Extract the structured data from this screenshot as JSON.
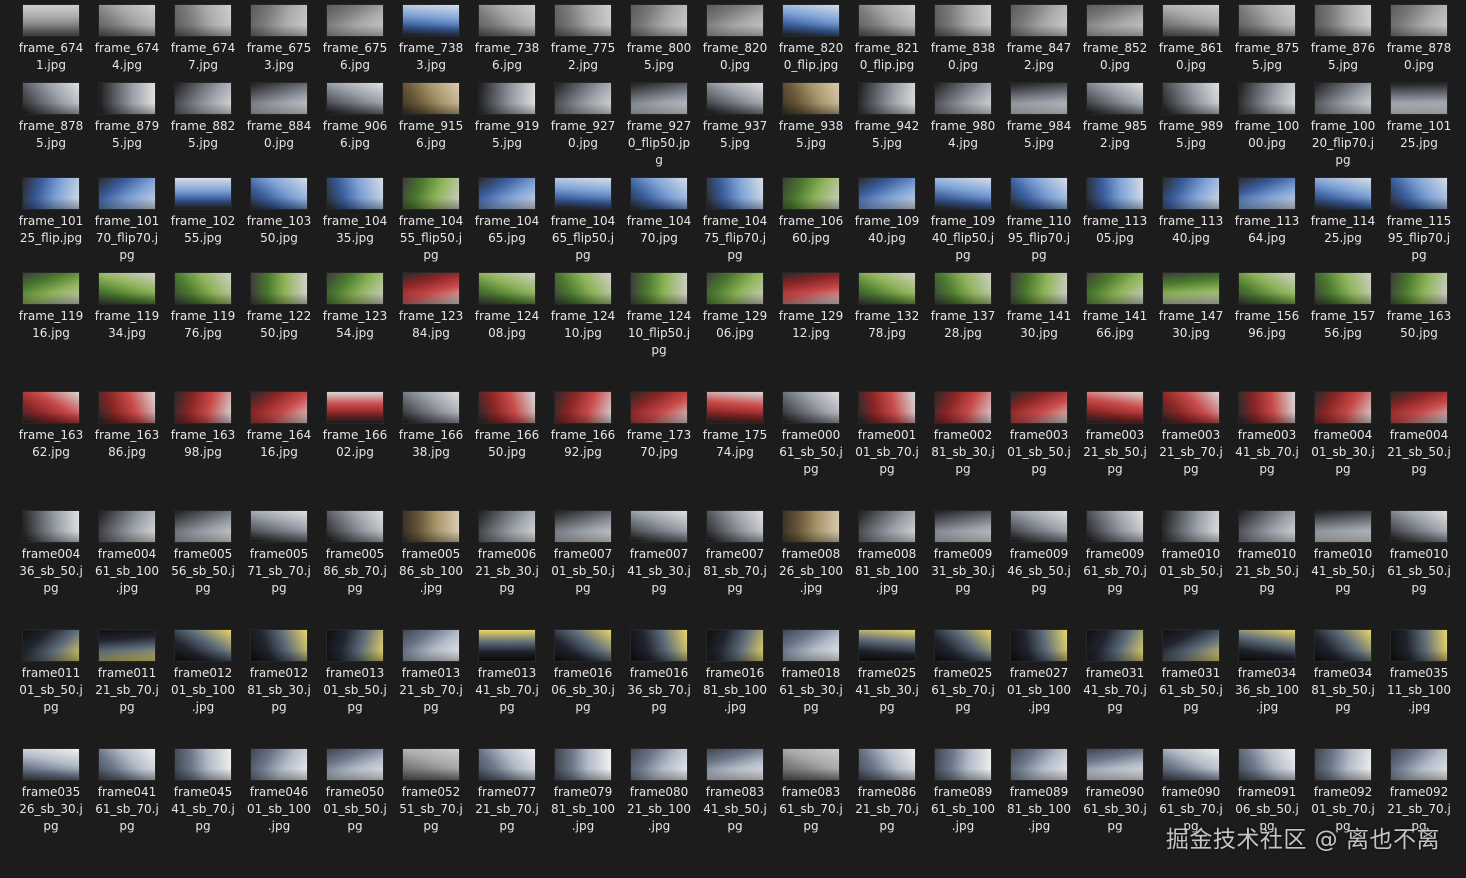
{
  "watermark": "掘金技术社区 @ 离也不离",
  "files": [
    [
      "frame_674\n1.jpg",
      "frame_674\n4.jpg",
      "frame_674\n7.jpg",
      "frame_675\n3.jpg",
      "frame_675\n6.jpg",
      "frame_738\n3.jpg",
      "frame_738\n6.jpg",
      "frame_775\n2.jpg",
      "frame_800\n5.jpg",
      "frame_820\n0.jpg",
      "frame_820\n0_flip.jpg",
      "frame_821\n0_flip.jpg",
      "frame_838\n0.jpg",
      "frame_847\n2.jpg",
      "frame_852\n0.jpg",
      "frame_861\n0.jpg",
      "frame_875\n5.jpg",
      "frame_876\n5.jpg",
      "frame_878\n0.jpg"
    ],
    [
      "frame_878\n5.jpg",
      "frame_879\n5.jpg",
      "frame_882\n5.jpg",
      "frame_884\n0.jpg",
      "frame_906\n6.jpg",
      "frame_915\n6.jpg",
      "frame_919\n5.jpg",
      "frame_927\n0.jpg",
      "frame_927\n0_flip50.jp\ng",
      "frame_937\n5.jpg",
      "frame_938\n5.jpg",
      "frame_942\n5.jpg",
      "frame_980\n4.jpg",
      "frame_984\n5.jpg",
      "frame_985\n2.jpg",
      "frame_989\n5.jpg",
      "frame_100\n00.jpg",
      "frame_100\n20_flip70.j\npg",
      "frame_101\n25.jpg"
    ],
    [
      "frame_101\n25_flip.jpg",
      "frame_101\n70_flip70.j\npg",
      "frame_102\n55.jpg",
      "frame_103\n50.jpg",
      "frame_104\n35.jpg",
      "frame_104\n55_flip50.j\npg",
      "frame_104\n65.jpg",
      "frame_104\n65_flip50.j\npg",
      "frame_104\n70.jpg",
      "frame_104\n75_flip70.j\npg",
      "frame_106\n60.jpg",
      "frame_109\n40.jpg",
      "frame_109\n40_flip50.j\npg",
      "frame_110\n95_flip70.j\npg",
      "frame_113\n05.jpg",
      "frame_113\n40.jpg",
      "frame_113\n64.jpg",
      "frame_114\n25.jpg",
      "frame_115\n95_flip70.j\npg"
    ],
    [
      "frame_119\n16.jpg",
      "frame_119\n34.jpg",
      "frame_119\n76.jpg",
      "frame_122\n50.jpg",
      "frame_123\n54.jpg",
      "frame_123\n84.jpg",
      "frame_124\n08.jpg",
      "frame_124\n10.jpg",
      "frame_124\n10_flip50.j\npg",
      "frame_129\n06.jpg",
      "frame_129\n12.jpg",
      "frame_132\n78.jpg",
      "frame_137\n28.jpg",
      "frame_141\n30.jpg",
      "frame_141\n66.jpg",
      "frame_147\n30.jpg",
      "frame_156\n96.jpg",
      "frame_157\n56.jpg",
      "frame_163\n50.jpg"
    ],
    [
      "frame_163\n62.jpg",
      "frame_163\n86.jpg",
      "frame_163\n98.jpg",
      "frame_164\n16.jpg",
      "frame_166\n02.jpg",
      "frame_166\n38.jpg",
      "frame_166\n50.jpg",
      "frame_166\n92.jpg",
      "frame_173\n70.jpg",
      "frame_175\n74.jpg",
      "frame000\n61_sb_50.j\npg",
      "frame001\n01_sb_70.j\npg",
      "frame002\n81_sb_30.j\npg",
      "frame003\n01_sb_50.j\npg",
      "frame003\n21_sb_50.j\npg",
      "frame003\n21_sb_70.j\npg",
      "frame003\n41_sb_70.j\npg",
      "frame004\n01_sb_30.j\npg",
      "frame004\n21_sb_50.j\npg"
    ],
    [
      "frame004\n36_sb_50.j\npg",
      "frame004\n61_sb_100\n.jpg",
      "frame005\n56_sb_50.j\npg",
      "frame005\n71_sb_70.j\npg",
      "frame005\n86_sb_70.j\npg",
      "frame005\n86_sb_100\n.jpg",
      "frame006\n21_sb_30.j\npg",
      "frame007\n01_sb_50.j\npg",
      "frame007\n41_sb_30.j\npg",
      "frame007\n81_sb_70.j\npg",
      "frame008\n26_sb_100\n.jpg",
      "frame008\n81_sb_100\n.jpg",
      "frame009\n31_sb_30.j\npg",
      "frame009\n46_sb_50.j\npg",
      "frame009\n61_sb_70.j\npg",
      "frame010\n01_sb_50.j\npg",
      "frame010\n21_sb_50.j\npg",
      "frame010\n41_sb_50.j\npg",
      "frame010\n61_sb_50.j\npg"
    ],
    [
      "frame011\n01_sb_50.j\npg",
      "frame011\n21_sb_70.j\npg",
      "frame012\n01_sb_100\n.jpg",
      "frame012\n81_sb_30.j\npg",
      "frame013\n01_sb_50.j\npg",
      "frame013\n21_sb_70.j\npg",
      "frame013\n41_sb_70.j\npg",
      "frame016\n06_sb_30.j\npg",
      "frame016\n36_sb_70.j\npg",
      "frame016\n81_sb_100\n.jpg",
      "frame018\n61_sb_30.j\npg",
      "frame025\n41_sb_30.j\npg",
      "frame025\n61_sb_70.j\npg",
      "frame027\n01_sb_100\n.jpg",
      "frame031\n41_sb_70.j\npg",
      "frame031\n61_sb_50.j\npg",
      "frame034\n36_sb_100\n.jpg",
      "frame034\n81_sb_50.j\npg",
      "frame035\n11_sb_100\n.jpg"
    ],
    [
      "frame035\n26_sb_30.j\npg",
      "frame041\n61_sb_70.j\npg",
      "frame045\n41_sb_70.j\npg",
      "frame046\n01_sb_100\n.jpg",
      "frame050\n01_sb_50.j\npg",
      "frame052\n51_sb_70.j\npg",
      "frame077\n21_sb_70.j\npg",
      "frame079\n81_sb_100\n.jpg",
      "frame080\n21_sb_100\n.jpg",
      "frame083\n41_sb_50.j\npg",
      "frame083\n61_sb_70.j\npg",
      "frame086\n21_sb_70.j\npg",
      "frame089\n61_sb_100\n.jpg",
      "frame089\n81_sb_100\n.jpg",
      "frame090\n61_sb_30.j\npg",
      "frame090\n61_sb_70.j\npg",
      "frame091\n06_sb_50.j\npg",
      "frame092\n01_sb_70.j\npg",
      "frame092\n21_sb_70.j\npg"
    ]
  ],
  "palettes": [
    [
      "#7a7a7a",
      "#a9a9a9",
      "#cfcfcf",
      "#5a5a5a"
    ],
    [
      "#3a5d9c",
      "#7fa3d6",
      "#d7dde8",
      "#2b2b2b"
    ],
    [
      "#4a7a2e",
      "#8fb35a",
      "#d0d0c8",
      "#3d3d3d"
    ],
    [
      "#8a2525",
      "#c94a4a",
      "#d8d8d8",
      "#2a2a2a"
    ],
    [
      "#5c5f66",
      "#9aa0a8",
      "#e0e0e0",
      "#1e1e1e"
    ],
    [
      "#6b5a3a",
      "#a8956b",
      "#d9ccb0",
      "#3a3226"
    ],
    [
      "#20242e",
      "#5d6b7a",
      "#e8d66a",
      "#101010"
    ],
    [
      "#6a7688",
      "#b4bcc8",
      "#f0f0f0",
      "#404650"
    ]
  ]
}
